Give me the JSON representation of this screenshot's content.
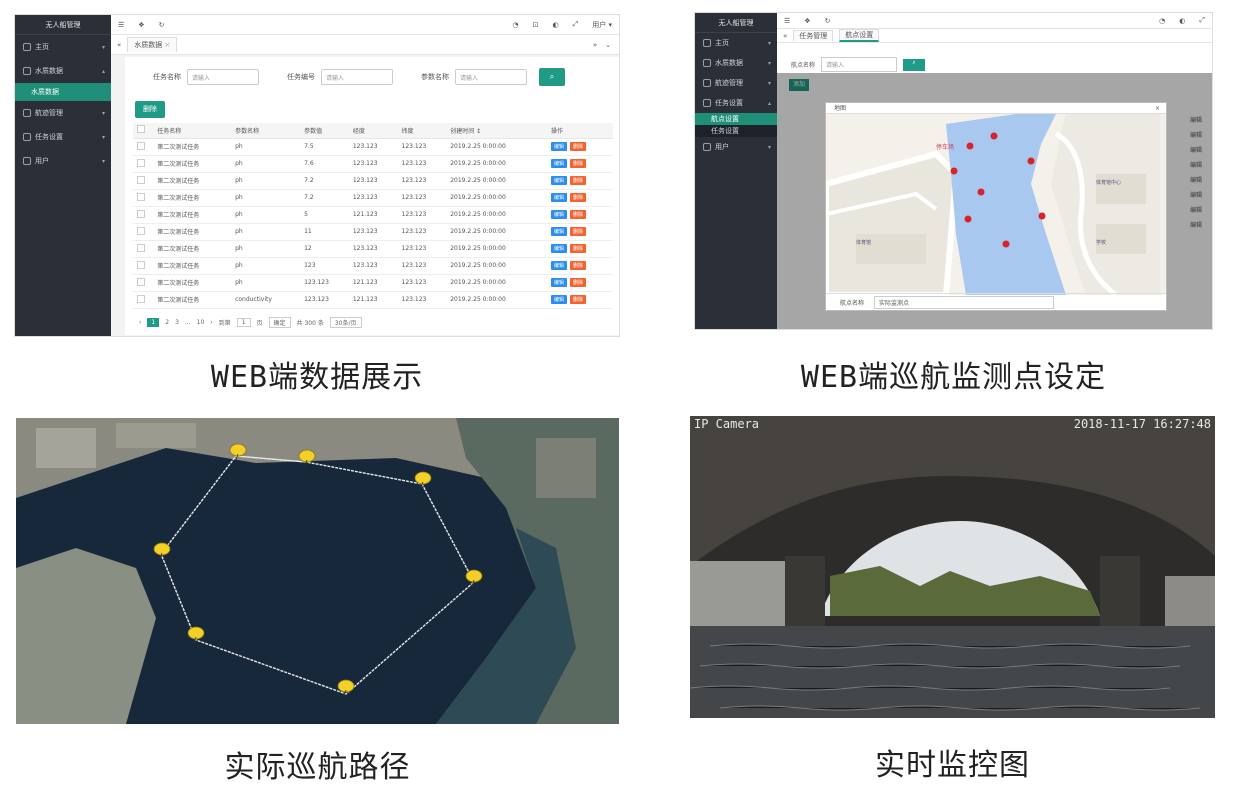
{
  "panel1": {
    "caption": "WEB端数据展示",
    "sidebar": {
      "title": "无人船管理",
      "items": [
        {
          "label": "主页",
          "expanded": false
        },
        {
          "label": "水质数据",
          "expanded": true,
          "sub": [
            "水质数据"
          ]
        },
        {
          "label": "航迹管理",
          "expanded": false
        },
        {
          "label": "任务设置",
          "expanded": false
        },
        {
          "label": "用户",
          "expanded": false
        }
      ]
    },
    "topbar": {
      "user": "用户",
      "user_caret": "▾"
    },
    "tab": {
      "label": "水质数据",
      "close": "×"
    },
    "filter": {
      "labels": [
        "任务名称",
        "任务编号",
        "参数名称"
      ],
      "placeholder": "请输入",
      "search_icon": "search-icon"
    },
    "delete_button": "删除",
    "table": {
      "headers": [
        "",
        "任务名称",
        "参数名称",
        "参数值",
        "经度",
        "纬度",
        "创建时间 ↕",
        "操作"
      ],
      "rows": [
        [
          "第二次测试任务",
          "ph",
          "7.5",
          "123.123",
          "123.123",
          "2019.2.25 0:00:00"
        ],
        [
          "第二次测试任务",
          "ph",
          "7.6",
          "123.123",
          "123.123",
          "2019.2.25 0:00:00"
        ],
        [
          "第二次测试任务",
          "ph",
          "7.2",
          "123.123",
          "123.123",
          "2019.2.25 0:00:00"
        ],
        [
          "第二次测试任务",
          "ph",
          "7.2",
          "123.123",
          "123.123",
          "2019.2.25 0:00:00"
        ],
        [
          "第二次测试任务",
          "ph",
          "5",
          "121.123",
          "123.123",
          "2019.2.25 0:00:00"
        ],
        [
          "第二次测试任务",
          "ph",
          "11",
          "123.123",
          "123.123",
          "2019.2.25 0:00:00"
        ],
        [
          "第二次测试任务",
          "ph",
          "12",
          "123.123",
          "123.123",
          "2019.2.25 0:00:00"
        ],
        [
          "第二次测试任务",
          "ph",
          "123",
          "123.123",
          "123.123",
          "2019.2.25 0:00:00"
        ],
        [
          "第二次测试任务",
          "ph",
          "123.123",
          "121.123",
          "123.123",
          "2019.2.25 0:00:00"
        ],
        [
          "第二次测试任务",
          "conductivity",
          "123.123",
          "121.123",
          "123.123",
          "2019.2.25 0:00:00"
        ]
      ],
      "edit_label": "编辑",
      "delete_label": "删除"
    },
    "pager": {
      "prev": "‹",
      "pages": [
        "1",
        "2",
        "3",
        "...",
        "10"
      ],
      "next": "›",
      "goto": "到第",
      "page_input": "1",
      "page_unit": "页",
      "confirm": "确定",
      "total": "共 300 条",
      "page_size": "30条/页"
    }
  },
  "panel2": {
    "caption": "WEB端巡航监测点设定",
    "sidebar": {
      "title": "无人船管理",
      "items": [
        "主页",
        "水质数据",
        "航迹管理",
        "任务设置",
        "用户"
      ],
      "sub": [
        "航点设置",
        "任务设置"
      ]
    },
    "tabs": [
      "任务管理",
      "航点设置"
    ],
    "filter": {
      "label": "航点名称",
      "placeholder": "请输入"
    },
    "add_button": "添加",
    "dialog": {
      "title": "地图",
      "close": "×",
      "map_labels": [
        "停车场",
        "体育馆中心",
        "体育馆",
        "学校"
      ],
      "footer_label": "航点名称",
      "footer_value": "实际监测点"
    },
    "row_actions": [
      "编辑",
      "编辑",
      "编辑",
      "编辑",
      "编辑",
      "编辑",
      "编辑",
      "编辑"
    ]
  },
  "panel3": {
    "caption": "实际巡航路径"
  },
  "panel4": {
    "caption": "实时监控图",
    "camera_label": "IP Camera",
    "timestamp": "2018-11-17 16:27:48"
  },
  "colors": {
    "accent": "#1f9b88",
    "sidebar": "#2a2f38",
    "edit": "#2d8cf0",
    "delete": "#f06430",
    "pin": "#f2d027",
    "map_water": "#a8c8f0",
    "marker": "#d9222a"
  }
}
